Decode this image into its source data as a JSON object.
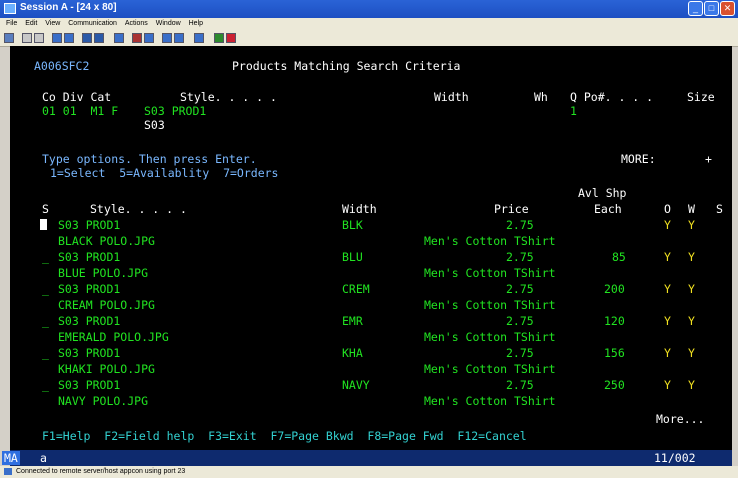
{
  "window": {
    "title": "Session A - [24 x 80]"
  },
  "menu": [
    "File",
    "Edit",
    "View",
    "Communication",
    "Actions",
    "Window",
    "Help"
  ],
  "screen": {
    "screen_id": "A006SFC2",
    "title": "Products Matching Search Criteria",
    "header_labels": {
      "co_div_cat": "Co Div Cat",
      "style": "Style. . . . .",
      "width": "Width",
      "wh": "Wh",
      "q_po": "Q Po#. . . .",
      "size": "Size"
    },
    "header_values": {
      "co_div_cat": "01 01  M1 F",
      "style": "S03 PROD1",
      "style2": "S03",
      "q": "1"
    },
    "instructions": "Type options. Then press Enter.",
    "options": "1=Select  5=Availablity  7=Orders",
    "more_label": "MORE:",
    "more_marker": "+",
    "col_avl_shp": "Avl Shp",
    "columns": {
      "s": "S",
      "style": "Style. . . . .",
      "width": "Width",
      "price": "Price",
      "each": "Each",
      "o": "O",
      "w": "W",
      "s2": "S"
    },
    "rows": [
      {
        "sel": "",
        "style": "S03 PROD1",
        "width": "BLK",
        "price": "2.75",
        "each": "",
        "o": "Y",
        "w": "Y",
        "image": "BLACK POLO.JPG",
        "desc": "Men's Cotton TShirt"
      },
      {
        "sel": "_",
        "style": "S03 PROD1",
        "width": "BLU",
        "price": "2.75",
        "each": "85",
        "o": "Y",
        "w": "Y",
        "image": "BLUE POLO.JPG",
        "desc": "Men's Cotton TShirt"
      },
      {
        "sel": "_",
        "style": "S03 PROD1",
        "width": "CREM",
        "price": "2.75",
        "each": "200",
        "o": "Y",
        "w": "Y",
        "image": "CREAM POLO.JPG",
        "desc": "Men's Cotton TShirt"
      },
      {
        "sel": "_",
        "style": "S03 PROD1",
        "width": "EMR",
        "price": "2.75",
        "each": "120",
        "o": "Y",
        "w": "Y",
        "image": "EMERALD POLO.JPG",
        "desc": "Men's Cotton TShirt"
      },
      {
        "sel": "_",
        "style": "S03 PROD1",
        "width": "KHA",
        "price": "2.75",
        "each": "156",
        "o": "Y",
        "w": "Y",
        "image": "KHAKI POLO.JPG",
        "desc": "Men's Cotton TShirt"
      },
      {
        "sel": "_",
        "style": "S03 PROD1",
        "width": "NAVY",
        "price": "2.75",
        "each": "250",
        "o": "Y",
        "w": "Y",
        "image": "NAVY POLO.JPG",
        "desc": "Men's Cotton TShirt"
      }
    ],
    "more_bottom": "More...",
    "fkeys": "F1=Help  F2=Field help  F3=Exit  F7=Page Bkwd  F8=Page Fwd  F12=Cancel"
  },
  "oia": {
    "ma": "MA",
    "a": "a",
    "position": "11/002"
  },
  "status": "Connected to remote server/host appcon using port 23"
}
